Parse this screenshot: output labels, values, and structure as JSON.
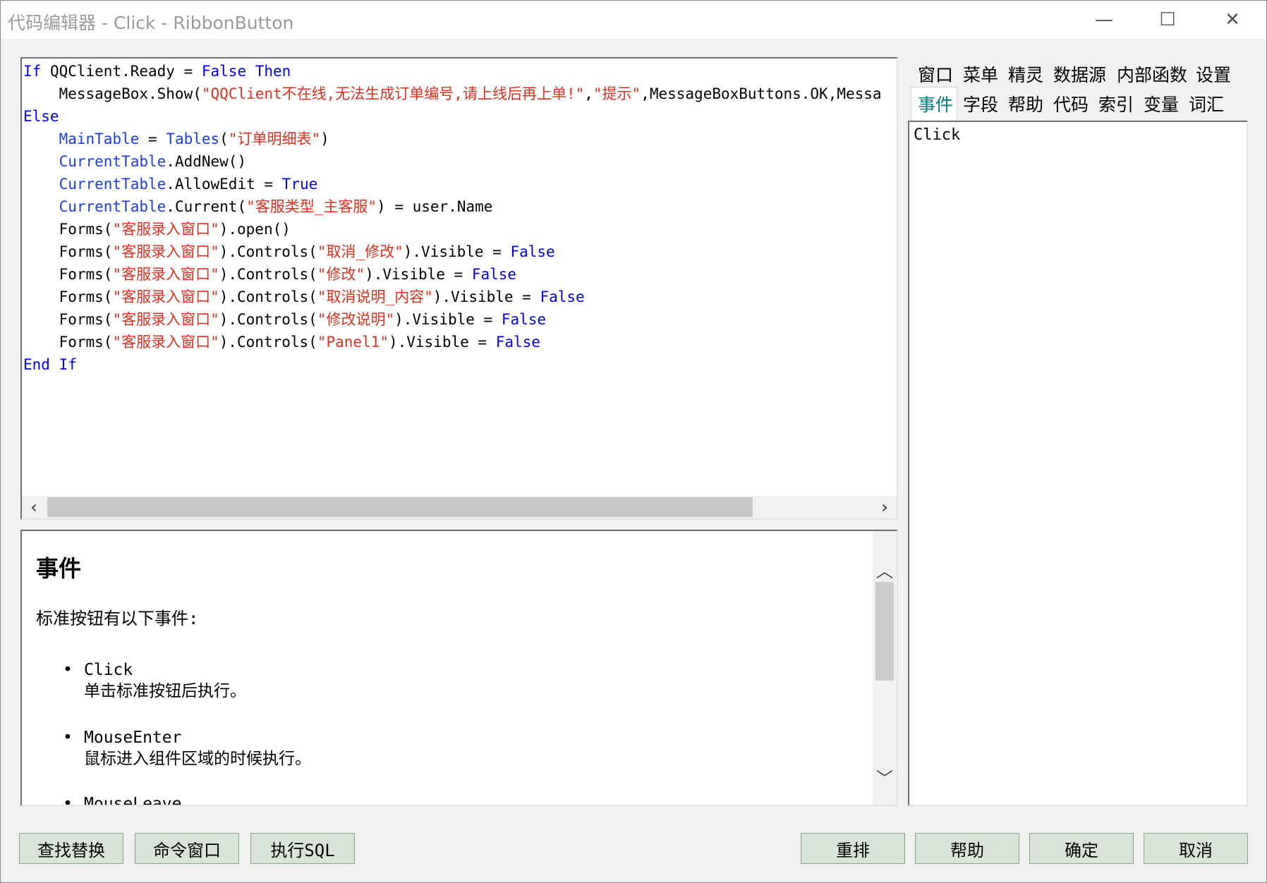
{
  "window": {
    "title": "代码编辑器 - Click - RibbonButton",
    "minimize": "—",
    "maximize": "☐",
    "close": "✕"
  },
  "code_lines": [
    [
      {
        "t": "kw",
        "v": "If"
      },
      {
        "t": "pl",
        "v": " QQClient.Ready = "
      },
      {
        "t": "kw",
        "v": "False"
      },
      {
        "t": "pl",
        "v": " "
      },
      {
        "t": "kw",
        "v": "Then"
      }
    ],
    [
      {
        "t": "pl",
        "v": "    MessageBox.Show("
      },
      {
        "t": "str",
        "v": "\"QQClient不在线,无法生成订单编号,请上线后再上单!\""
      },
      {
        "t": "pl",
        "v": ","
      },
      {
        "t": "str",
        "v": "\"提示\""
      },
      {
        "t": "pl",
        "v": ",MessageBoxButtons.OK,Messa"
      }
    ],
    [
      {
        "t": "kw",
        "v": "Else"
      }
    ],
    [
      {
        "t": "pl",
        "v": "    "
      },
      {
        "t": "id",
        "v": "MainTable"
      },
      {
        "t": "pl",
        "v": " = "
      },
      {
        "t": "id",
        "v": "Tables"
      },
      {
        "t": "pl",
        "v": "("
      },
      {
        "t": "str",
        "v": "\"订单明细表\""
      },
      {
        "t": "pl",
        "v": ")"
      }
    ],
    [
      {
        "t": "pl",
        "v": "    "
      },
      {
        "t": "id",
        "v": "CurrentTable"
      },
      {
        "t": "pl",
        "v": ".AddNew()"
      }
    ],
    [
      {
        "t": "pl",
        "v": "    "
      },
      {
        "t": "id",
        "v": "CurrentTable"
      },
      {
        "t": "pl",
        "v": ".AllowEdit = "
      },
      {
        "t": "kw",
        "v": "True"
      }
    ],
    [
      {
        "t": "pl",
        "v": "    "
      },
      {
        "t": "id",
        "v": "CurrentTable"
      },
      {
        "t": "pl",
        "v": ".Current("
      },
      {
        "t": "str",
        "v": "\"客服类型_主客服\""
      },
      {
        "t": "pl",
        "v": ") = user.Name"
      }
    ],
    [
      {
        "t": "pl",
        "v": "    Forms("
      },
      {
        "t": "str",
        "v": "\"客服录入窗口\""
      },
      {
        "t": "pl",
        "v": ").open()"
      }
    ],
    [
      {
        "t": "pl",
        "v": "    Forms("
      },
      {
        "t": "str",
        "v": "\"客服录入窗口\""
      },
      {
        "t": "pl",
        "v": ").Controls("
      },
      {
        "t": "str",
        "v": "\"取消_修改\""
      },
      {
        "t": "pl",
        "v": ").Visible = "
      },
      {
        "t": "kw",
        "v": "False"
      }
    ],
    [
      {
        "t": "pl",
        "v": "    Forms("
      },
      {
        "t": "str",
        "v": "\"客服录入窗口\""
      },
      {
        "t": "pl",
        "v": ").Controls("
      },
      {
        "t": "str",
        "v": "\"修改\""
      },
      {
        "t": "pl",
        "v": ").Visible = "
      },
      {
        "t": "kw",
        "v": "False"
      }
    ],
    [
      {
        "t": "pl",
        "v": "    Forms("
      },
      {
        "t": "str",
        "v": "\"客服录入窗口\""
      },
      {
        "t": "pl",
        "v": ").Controls("
      },
      {
        "t": "str",
        "v": "\"取消说明_内容\""
      },
      {
        "t": "pl",
        "v": ").Visible = "
      },
      {
        "t": "kw",
        "v": "False"
      }
    ],
    [
      {
        "t": "pl",
        "v": "    Forms("
      },
      {
        "t": "str",
        "v": "\"客服录入窗口\""
      },
      {
        "t": "pl",
        "v": ").Controls("
      },
      {
        "t": "str",
        "v": "\"修改说明\""
      },
      {
        "t": "pl",
        "v": ").Visible = "
      },
      {
        "t": "kw",
        "v": "False"
      }
    ],
    [
      {
        "t": "pl",
        "v": "    Forms("
      },
      {
        "t": "str",
        "v": "\"客服录入窗口\""
      },
      {
        "t": "pl",
        "v": ").Controls("
      },
      {
        "t": "str",
        "v": "\"Panel1\""
      },
      {
        "t": "pl",
        "v": ").Visible = "
      },
      {
        "t": "kw",
        "v": "False"
      }
    ],
    [
      {
        "t": "kw",
        "v": "End If"
      }
    ]
  ],
  "editor_scroll": {
    "left": "‹",
    "right": "›"
  },
  "help": {
    "title": "事件",
    "intro": "标准按钮有以下事件:",
    "items": [
      {
        "name": "Click",
        "desc": "单击标准按钮后执行。"
      },
      {
        "name": "MouseEnter",
        "desc": "鼠标进入组件区域的时候执行。"
      },
      {
        "name": "MouseLeave",
        "desc": ""
      }
    ],
    "scroll_up": "︿",
    "scroll_down": "﹀",
    "bullet": "•"
  },
  "tabs_row1": [
    "窗口",
    "菜单",
    "精灵",
    "数据源",
    "内部函数",
    "设置"
  ],
  "tabs_row2": [
    "事件",
    "字段",
    "帮助",
    "代码",
    "索引",
    "变量",
    "词汇"
  ],
  "active_tab": "事件",
  "event_list": [
    "Click"
  ],
  "buttons_left": [
    "查找替换",
    "命令窗口",
    "执行SQL"
  ],
  "buttons_right": [
    "重排",
    "帮助",
    "确定",
    "取消"
  ],
  "colors": {
    "keyword": "#0000ff",
    "identifier": "#1a3ee8",
    "string": "#e0301e",
    "button_bg": "#d8e4d8",
    "active_tab": "#008080"
  }
}
